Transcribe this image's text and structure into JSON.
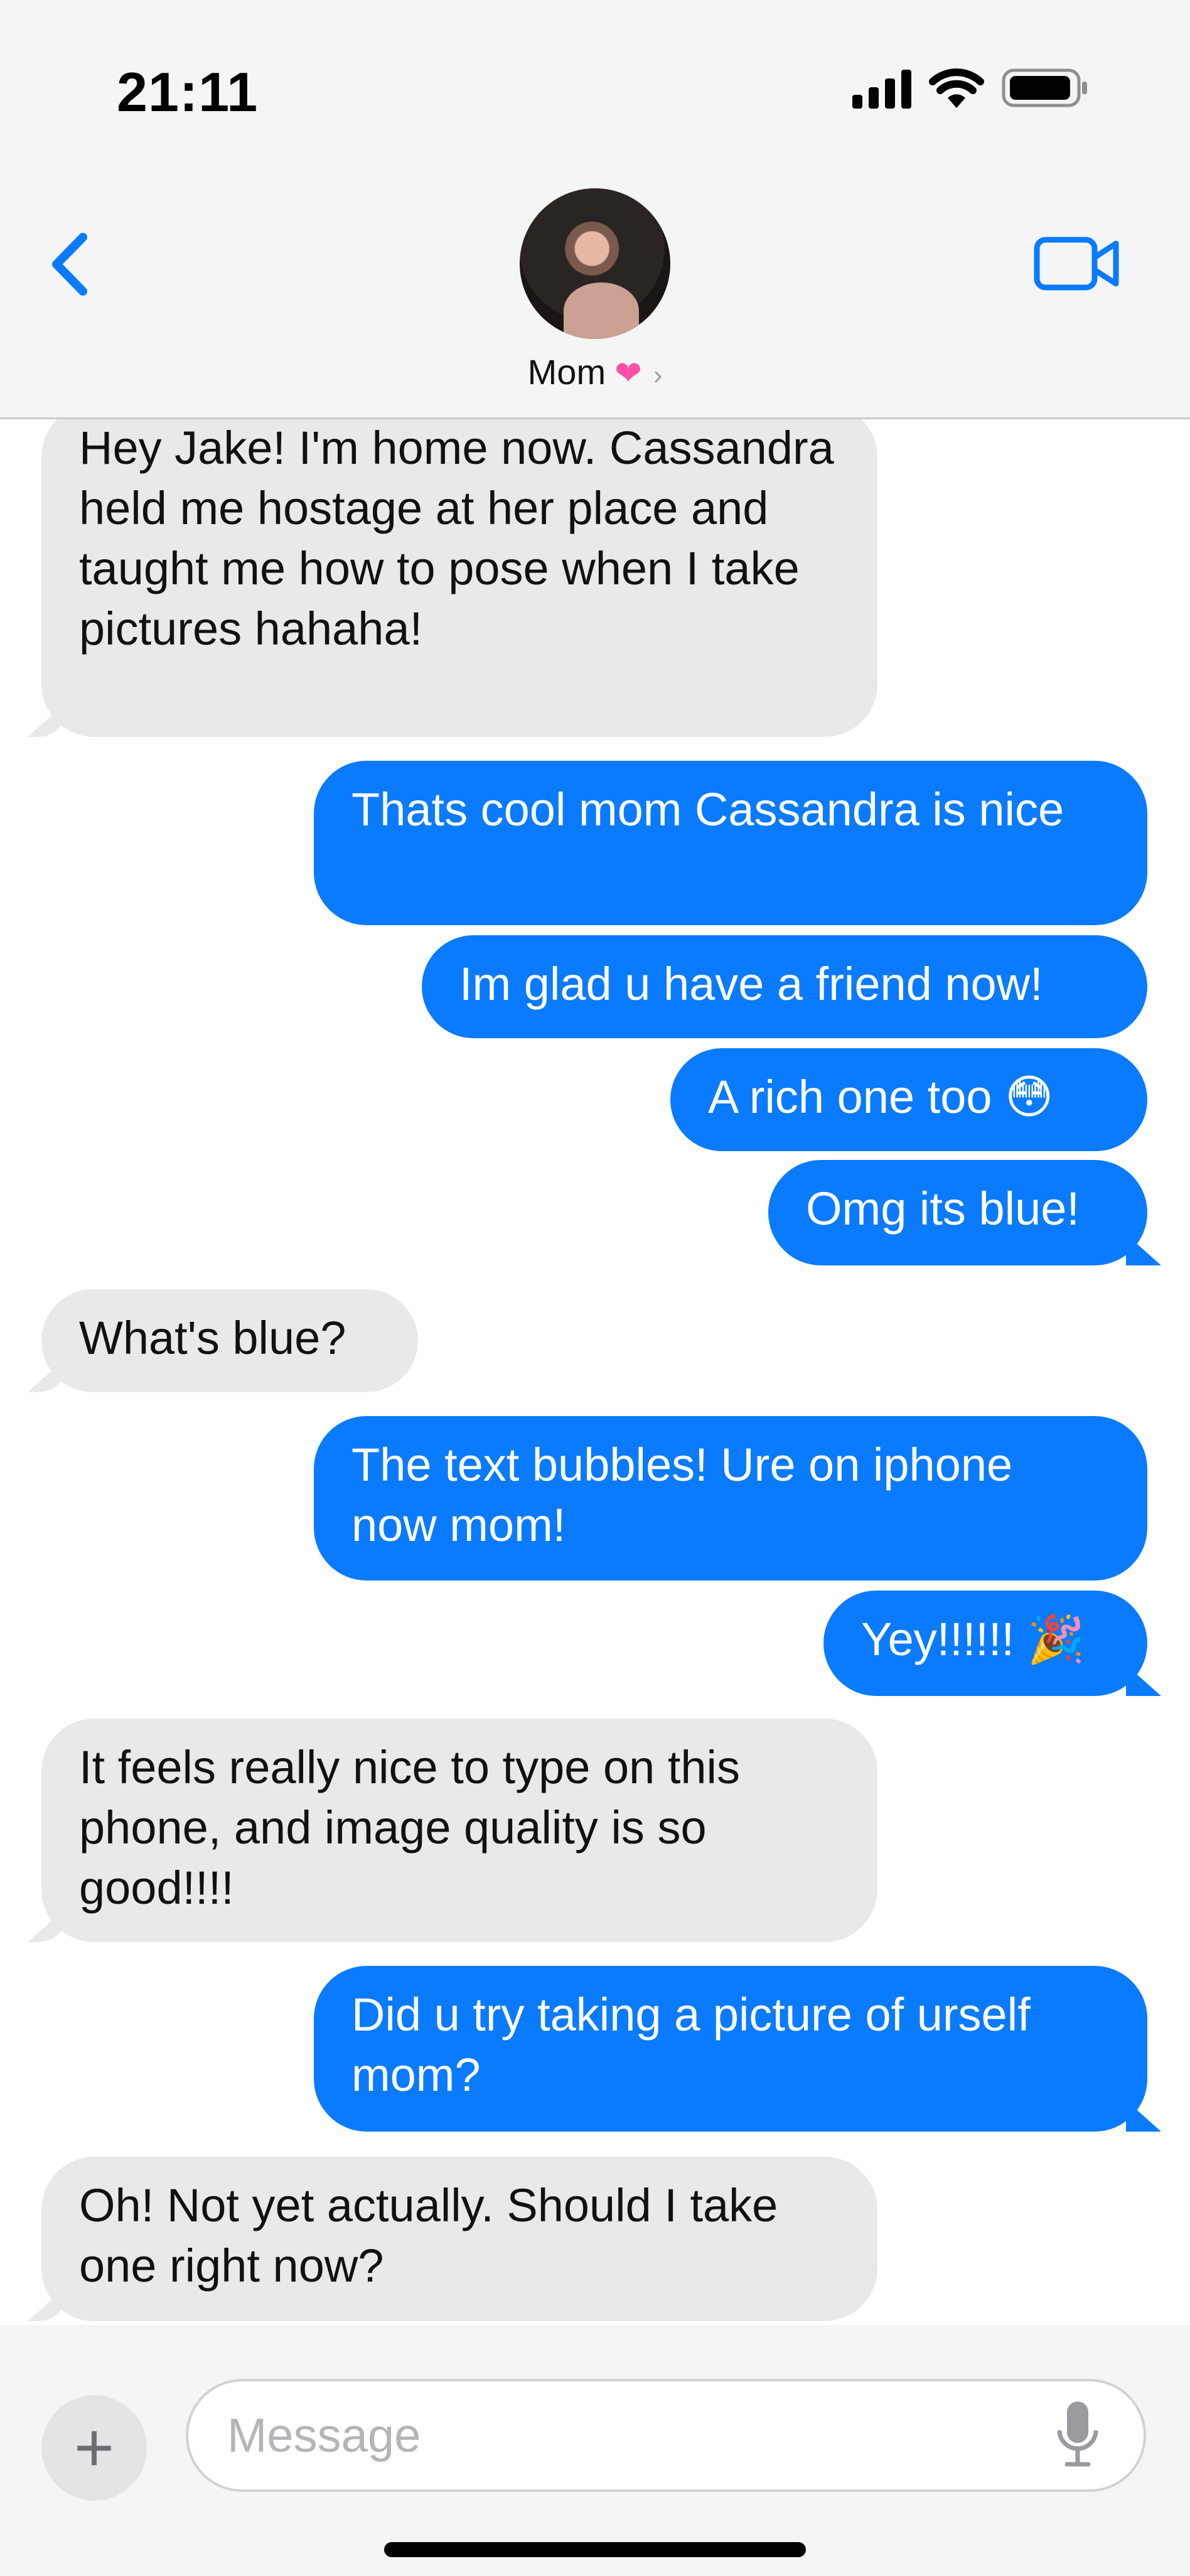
{
  "status_bar": {
    "time": "21:11"
  },
  "header": {
    "contact_name": "Mom",
    "contact_emoji": "❤",
    "chevron": "›"
  },
  "icons": {
    "back": "chevron-left-icon",
    "video": "video-camera-icon",
    "mic": "microphone-icon",
    "plus": "plus-icon"
  },
  "colors": {
    "sent_bubble": "#0a7bfe",
    "received_bubble": "#e9e9eb",
    "accent": "#0a7bfe",
    "heart": "#ff4fa6"
  },
  "messages": [
    {
      "from": "them",
      "text": "Hey Jake! I'm home now. Cassandra held me hostage at her place and taught me how to pose when I take pictures hahaha!"
    },
    {
      "from": "me",
      "text": "Thats cool mom Cassandra is nice"
    },
    {
      "from": "me",
      "text": "Im glad u have a friend now!"
    },
    {
      "from": "me",
      "text": "A rich one too 😳"
    },
    {
      "from": "me",
      "text": "Omg its blue!"
    },
    {
      "from": "them",
      "text": "What's blue?"
    },
    {
      "from": "me",
      "text": "The text bubbles! Ure on iphone now mom!"
    },
    {
      "from": "me",
      "text": "Yey!!!!!! 🎉"
    },
    {
      "from": "them",
      "text": "It feels really nice to type on this phone, and image quality is so good!!!!"
    },
    {
      "from": "me",
      "text": "Did u try taking a picture of urself mom?"
    },
    {
      "from": "them",
      "text": "Oh! Not yet actually. Should I take one right now?"
    }
  ],
  "composer": {
    "plus_label": "+",
    "placeholder": "Message",
    "value": ""
  }
}
